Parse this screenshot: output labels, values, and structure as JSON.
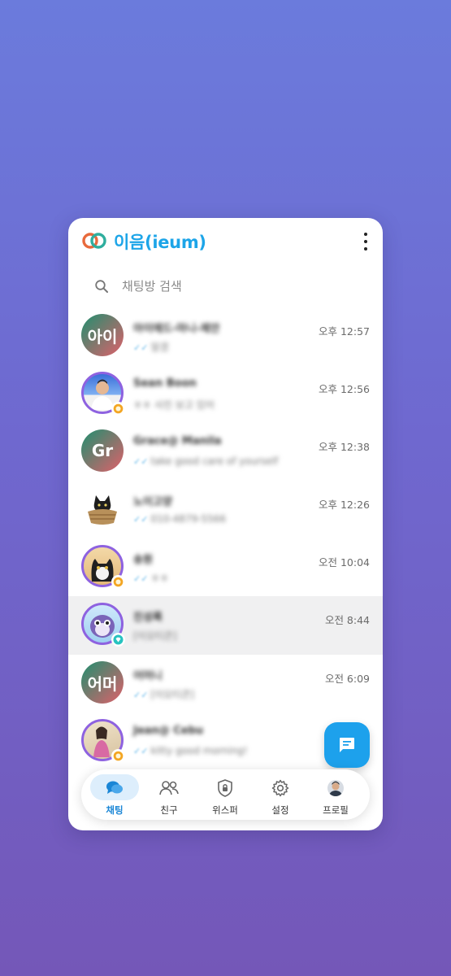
{
  "app": {
    "title": "이음(ieum)"
  },
  "search": {
    "placeholder": "채팅방 검색"
  },
  "chats": [
    {
      "avatar_text": "아이",
      "name": "아이에드-마니-제안",
      "preview": "알겠",
      "time": "오후 12:57"
    },
    {
      "avatar_text": "",
      "name": "Sean Boon",
      "preview": "ㅎㅎ 사진 보고 있어",
      "time": "오후 12:56"
    },
    {
      "avatar_text": "Gr",
      "name": "Grace@ Manila",
      "preview": "take good care of yourself",
      "time": "오후 12:38"
    },
    {
      "avatar_text": "",
      "name": "노이고양",
      "preview": "010-4879-5566",
      "time": "오후 12:26"
    },
    {
      "avatar_text": "",
      "name": "송원",
      "preview": "ㅎㅎ",
      "time": "오전 10:04"
    },
    {
      "avatar_text": "",
      "name": "진성록",
      "preview": "[이모티콘]",
      "time": "오전 8:44"
    },
    {
      "avatar_text": "어머",
      "name": "어머니",
      "preview": "[이모티콘]",
      "time": "오전 6:09"
    },
    {
      "avatar_text": "",
      "name": "Jean@ Cebu",
      "preview": "kitty good morning!",
      "time": ""
    }
  ],
  "nav": [
    {
      "label": "채팅",
      "icon": "chat-icon",
      "active": true
    },
    {
      "label": "친구",
      "icon": "friends-icon"
    },
    {
      "label": "위스퍼",
      "icon": "lock-shield-icon"
    },
    {
      "label": "설정",
      "icon": "gear-icon"
    },
    {
      "label": "프로필",
      "icon": "profile-avatar-icon"
    }
  ],
  "colors": {
    "accent": "#1da5e8",
    "fab": "#1da1ec",
    "ring": "#8e62e0"
  }
}
